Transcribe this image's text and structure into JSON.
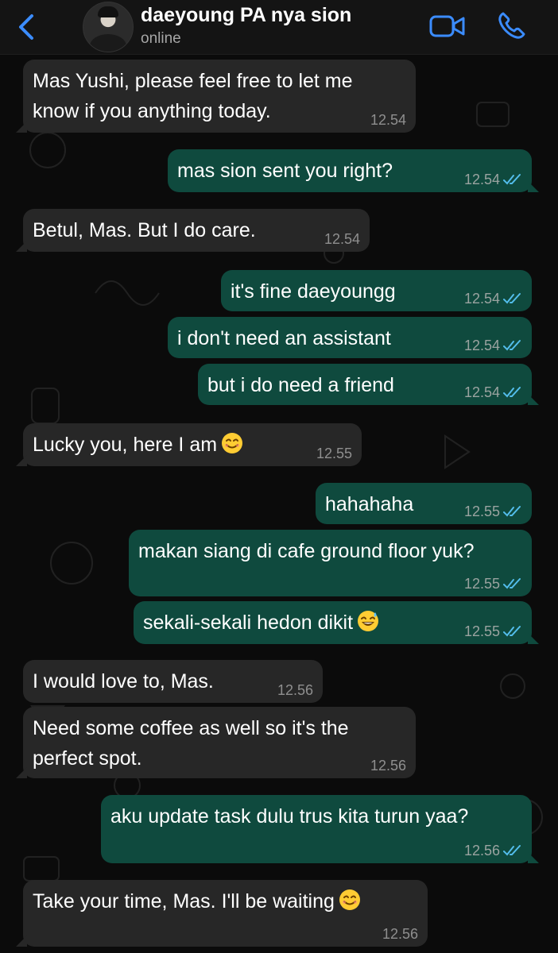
{
  "header": {
    "contact_name": "daeyoung PA nya sion",
    "status": "online"
  },
  "colors": {
    "accent": "#3b8cff",
    "incoming_bubble": "#272727",
    "outgoing_bubble": "#0f4a3e",
    "read_ticks": "#53bdeb"
  },
  "messages": [
    {
      "dir": "in",
      "text": "Mas Yushi, please feel free to let me\nknow if you anything today.",
      "time": "12.54"
    },
    {
      "dir": "out",
      "text": "mas sion sent you right?",
      "time": "12.54",
      "status": "read"
    },
    {
      "dir": "in",
      "text": "Betul, Mas. But I do care.",
      "time": "12.54"
    },
    {
      "dir": "out",
      "text": "it's fine daeyoungg",
      "time": "12.54",
      "status": "read"
    },
    {
      "dir": "out",
      "text": "i don't need an assistant",
      "time": "12.54",
      "status": "read"
    },
    {
      "dir": "out",
      "text": "but i do need a friend",
      "time": "12.54",
      "status": "read"
    },
    {
      "dir": "in",
      "text": "Lucky you, here I am",
      "emoji": "smiling-face-emoji",
      "time": "12.55"
    },
    {
      "dir": "out",
      "text": "hahahaha",
      "time": "12.55",
      "status": "read"
    },
    {
      "dir": "out",
      "text": "makan siang di cafe ground floor yuk?",
      "time": "12.55",
      "status": "read"
    },
    {
      "dir": "out",
      "text": "sekali-sekali hedon dikit",
      "emoji": "grinning-sweat-emoji",
      "time": "12.55",
      "status": "read"
    },
    {
      "dir": "in",
      "text": "I would love to, Mas.",
      "time": "12.56"
    },
    {
      "dir": "in",
      "text": "Need some coffee as well so it's the\nperfect spot.",
      "time": "12.56"
    },
    {
      "dir": "out",
      "text": "aku update task dulu trus kita turun yaa?",
      "time": "12.56",
      "status": "read"
    },
    {
      "dir": "in",
      "text": "Take your time, Mas. I'll be waiting",
      "emoji": "smiling-face-emoji",
      "time": "12.56"
    }
  ]
}
